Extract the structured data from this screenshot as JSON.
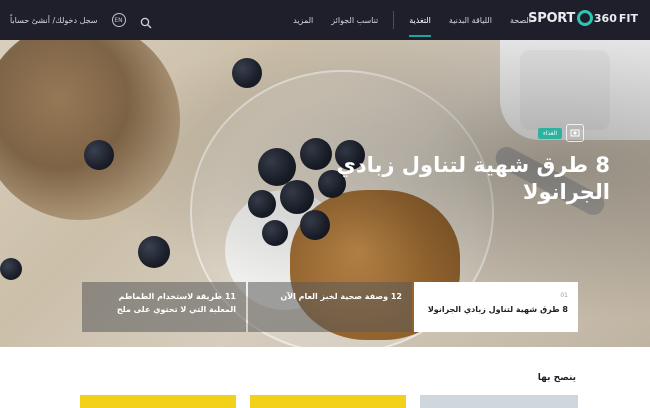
{
  "nav": {
    "logo": {
      "part1": "SPORT",
      "part2": "360",
      "part3": "FIT"
    },
    "items": [
      {
        "label": "الصحة",
        "active": false
      },
      {
        "label": "اللياقة البدنية",
        "active": false
      },
      {
        "label": "التغذية",
        "active": true
      },
      {
        "label": "تناسب الجوائز",
        "active": false
      },
      {
        "label": "المزيد",
        "active": false
      }
    ],
    "language": "EN",
    "login_label": "سجل دخولك/ أنشئ حساباً"
  },
  "hero": {
    "category": "الغذاء",
    "headline": "8 طرق شهية لتناول زبادي الجرانولا",
    "cards": [
      {
        "num": "01",
        "title": "8 طرق شهية لتناول زبادي الجرانولا",
        "active": true
      },
      {
        "num": "",
        "title": "12 وصفة صحية لخبز العام الآن",
        "active": false
      },
      {
        "num": "",
        "title": "11 طريقة لاستخدام الطماطم المعلبة التي لا تحتوي على ملح",
        "active": false
      }
    ]
  },
  "section": {
    "title": "ينصح بها"
  },
  "colors": {
    "nav_bg": "#1e1f2a",
    "accent": "#2cb3a0",
    "yellow": "#f2d11a"
  }
}
